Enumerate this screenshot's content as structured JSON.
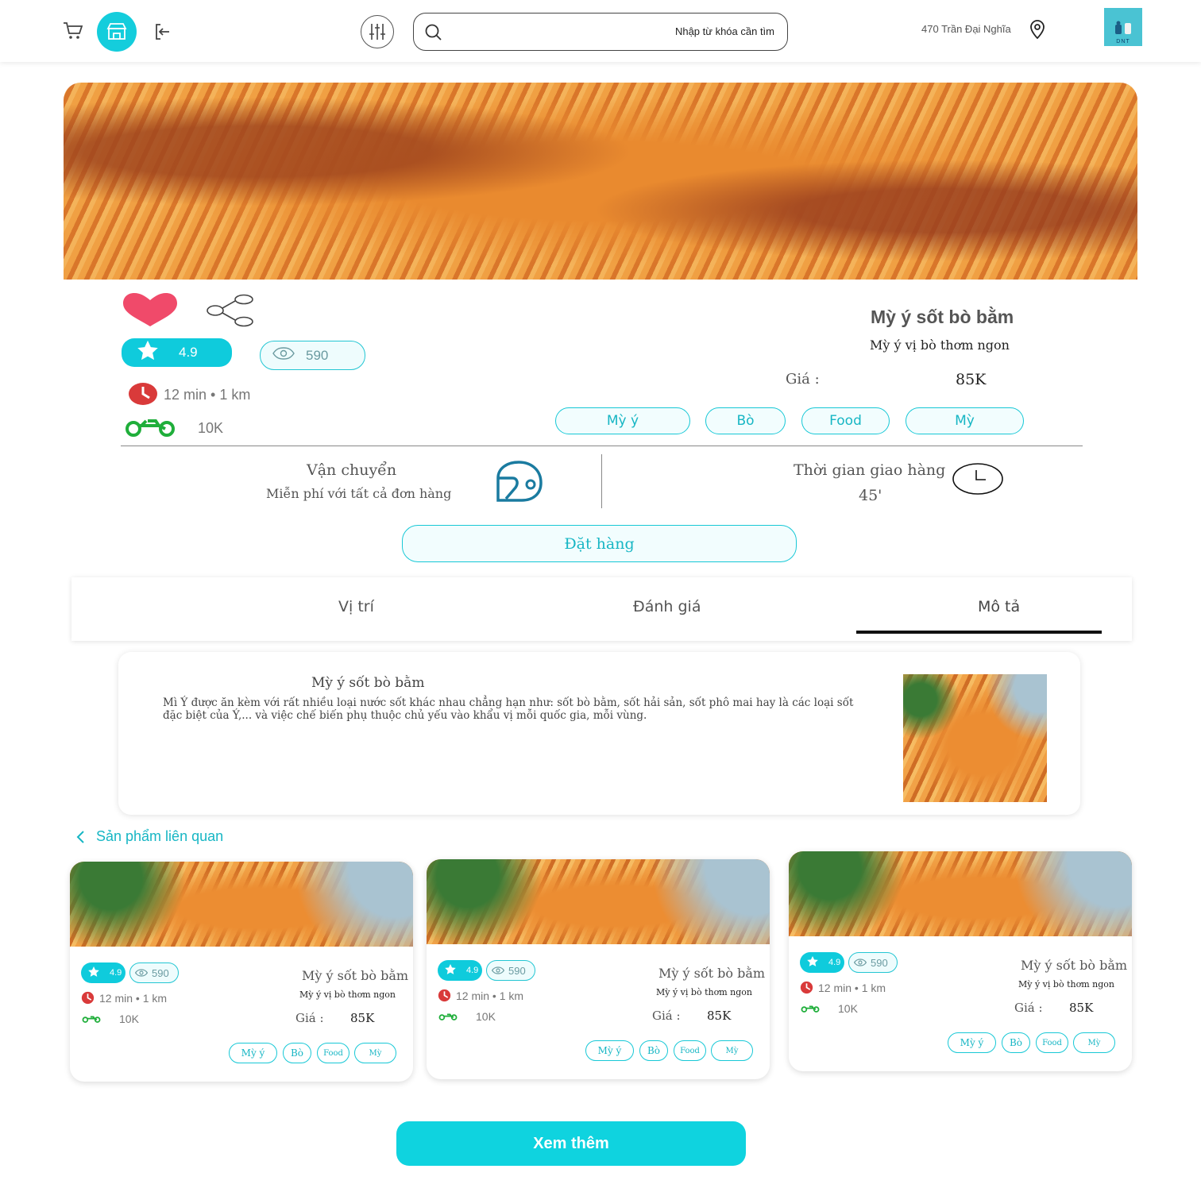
{
  "header": {
    "search_placeholder": "Nhập từ khóa cần tìm",
    "address": "470 Trần Đại Nghĩa",
    "avatar_text": "DNT"
  },
  "product": {
    "name": "Mỳ ý sốt bò bằm",
    "subtitle": "Mỳ ý vị bò thơm ngon",
    "price_label": "Giá :",
    "price": "85K",
    "rating": "4.9",
    "views": "590",
    "time_distance": "12 min • 1 km",
    "ship_fee": "10K",
    "tags": [
      "Mỳ ý",
      "Bò",
      "Food",
      "Mỳ"
    ]
  },
  "shipping": {
    "title": "Vận chuyển",
    "text": "Miễn phí  với tất cả đơn hàng"
  },
  "delivery": {
    "title": "Thời gian giao hàng",
    "time": "45'"
  },
  "order_button": "Đặt hàng",
  "tabs": [
    "Vị trí",
    "Đánh giá",
    "Mô tả"
  ],
  "description": {
    "title": "Mỳ ý sốt bò bằm",
    "text": "Mì Ý được ăn kèm với rất nhiều loại nước sốt khác nhau chẳng hạn như: sốt bò bằm, sốt hải sản, sốt phô mai hay là các loại sốt đặc biệt của Ý,... và việc chế biến phụ thuộc chủ yếu vào khẩu vị mỗi quốc gia, mỗi vùng."
  },
  "related": {
    "title": "Sản phẩm liên quan",
    "cards": [
      {
        "rating": "4.9",
        "views": "590",
        "time": "12 min • 1 km",
        "fee": "10K",
        "name": "Mỳ ý sốt bò bằm",
        "subtitle": "Mỳ ý vị bò thơm ngon",
        "price_label": "Giá :",
        "price": "85K",
        "tags": [
          "Mỳ ý",
          "Bò",
          "Food",
          "Mỳ"
        ]
      },
      {
        "rating": "4.9",
        "views": "590",
        "time": "12 min • 1 km",
        "fee": "10K",
        "name": "Mỳ ý sốt bò bằm",
        "subtitle": "Mỳ ý vị bò thơm ngon",
        "price_label": "Giá :",
        "price": "85K",
        "tags": [
          "Mỳ ý",
          "Bò",
          "Food",
          "Mỳ"
        ]
      },
      {
        "rating": "4.9",
        "views": "590",
        "time": "12 min • 1 km",
        "fee": "10K",
        "name": "Mỳ ý sốt bò bằm",
        "subtitle": "Mỳ ý vị bò thơm ngon",
        "price_label": "Giá :",
        "price": "85K",
        "tags": [
          "Mỳ ý",
          "Bò",
          "Food",
          "Mỳ"
        ]
      }
    ]
  },
  "more_button": "Xem thêm",
  "colors": {
    "accent": "#0fcbdc",
    "heart": "#f04a6a",
    "clock": "#d93a3a",
    "bike": "#1fae3a"
  }
}
